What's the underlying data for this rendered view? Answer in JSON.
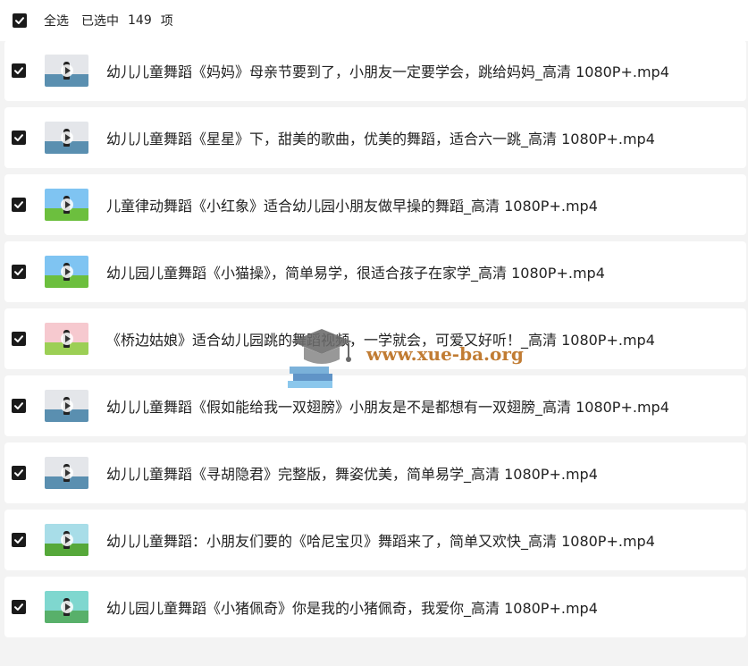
{
  "header": {
    "select_all_label": "全选",
    "selected_label": "已选中",
    "selected_count": "149",
    "unit_label": "项",
    "all_checked": true
  },
  "watermark": {
    "text": "www.xue-ba.org"
  },
  "files": [
    {
      "name": "",
      "checked": true,
      "thumb": "teal"
    },
    {
      "name": "幼儿儿童舞蹈《妈妈》母亲节要到了，小朋友一定要学会，跳给妈妈_高清 1080P+.mp4",
      "checked": true,
      "thumb": "gray"
    },
    {
      "name": "幼儿儿童舞蹈《星星》下，甜美的歌曲，优美的舞蹈，适合六一跳_高清 1080P+.mp4",
      "checked": true,
      "thumb": "gray"
    },
    {
      "name": "儿童律动舞蹈《小红象》适合幼儿园小朋友做早操的舞蹈_高清 1080P+.mp4",
      "checked": true,
      "thumb": "blue"
    },
    {
      "name": "幼儿园儿童舞蹈《小猫操》，简单易学，很适合孩子在家学_高清 1080P+.mp4",
      "checked": true,
      "thumb": "blue"
    },
    {
      "name": "《桥边姑娘》适合幼儿园跳的舞蹈视频，一学就会，可爱又好听！_高清 1080P+.mp4",
      "checked": true,
      "thumb": "pink"
    },
    {
      "name": "幼儿儿童舞蹈《假如能给我一双翅膀》小朋友是不是都想有一双翅膀_高清 1080P+.mp4",
      "checked": true,
      "thumb": "gray"
    },
    {
      "name": "幼儿儿童舞蹈《寻胡隐君》完整版，舞姿优美，简单易学_高清 1080P+.mp4",
      "checked": true,
      "thumb": "gray"
    },
    {
      "name": "幼儿儿童舞蹈：小朋友们要的《哈尼宝贝》舞蹈来了，简单又欢快_高清 1080P+.mp4",
      "checked": true,
      "thumb": "green"
    },
    {
      "name": "幼儿园儿童舞蹈《小猪佩奇》你是我的小猪佩奇，我爱你_高清 1080P+.mp4",
      "checked": true,
      "thumb": "teal"
    }
  ]
}
